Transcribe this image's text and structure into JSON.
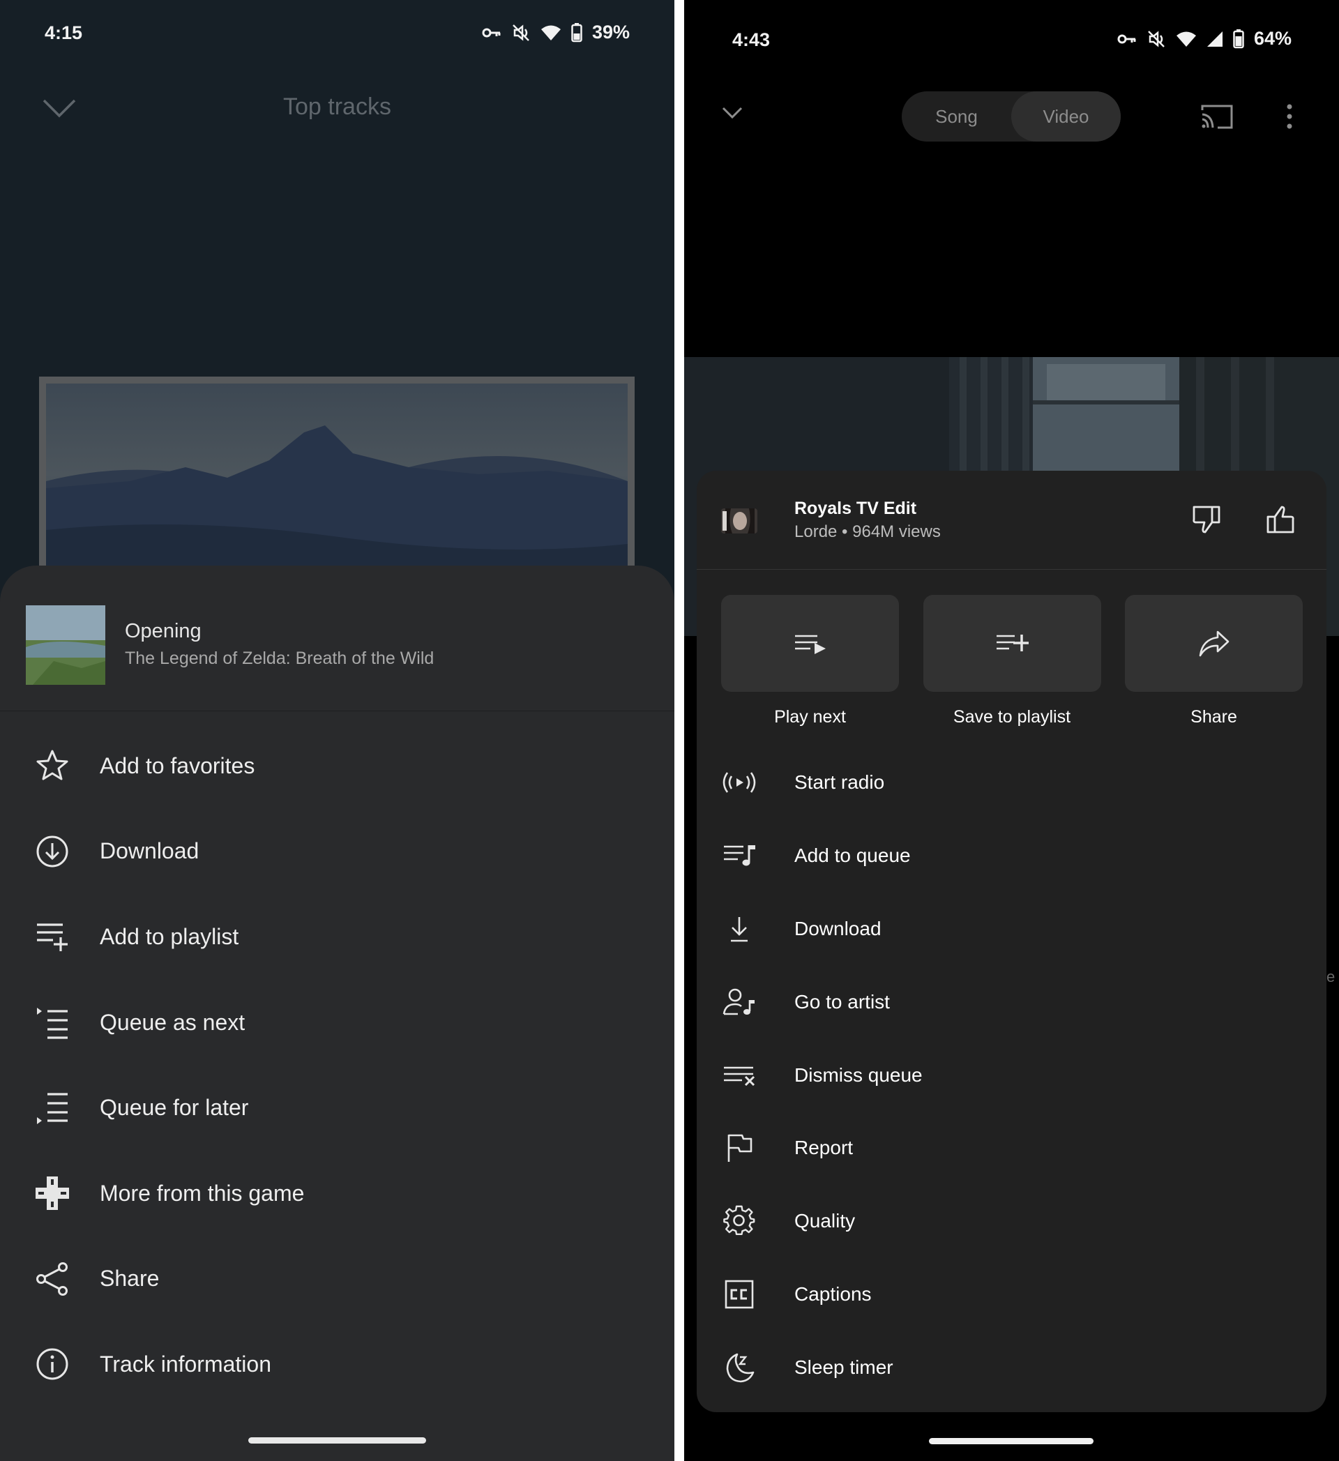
{
  "left": {
    "status": {
      "time": "4:15",
      "battery": "39%"
    },
    "header": {
      "title": "Top tracks"
    },
    "track": {
      "title": "Opening",
      "subtitle": "The Legend of Zelda: Breath of the Wild"
    },
    "menu": [
      {
        "label": "Add to favorites",
        "icon": "star-icon"
      },
      {
        "label": "Download",
        "icon": "download-circle-icon"
      },
      {
        "label": "Add to playlist",
        "icon": "playlist-add-icon"
      },
      {
        "label": "Queue as next",
        "icon": "queue-next-icon"
      },
      {
        "label": "Queue for later",
        "icon": "queue-later-icon"
      },
      {
        "label": "More from this game",
        "icon": "gamepad-icon"
      },
      {
        "label": "Share",
        "icon": "share-nodes-icon"
      },
      {
        "label": "Track information",
        "icon": "info-icon"
      }
    ]
  },
  "right": {
    "status": {
      "time": "4:43",
      "battery": "64%"
    },
    "toggle": {
      "song": "Song",
      "video": "Video"
    },
    "video": {
      "title": "Royals TV Edit",
      "subtitle": "Lorde • 964M views"
    },
    "actions": [
      {
        "label": "Play next",
        "icon": "play-next-icon"
      },
      {
        "label": "Save to playlist",
        "icon": "save-playlist-icon"
      },
      {
        "label": "Share",
        "icon": "share-arrow-icon"
      }
    ],
    "menu": [
      {
        "label": "Start radio",
        "icon": "radio-icon"
      },
      {
        "label": "Add to queue",
        "icon": "add-queue-icon"
      },
      {
        "label": "Download",
        "icon": "download-icon"
      },
      {
        "label": "Go to artist",
        "icon": "artist-icon"
      },
      {
        "label": "Dismiss queue",
        "icon": "dismiss-queue-icon"
      },
      {
        "label": "Report",
        "icon": "flag-icon"
      },
      {
        "label": "Quality",
        "icon": "gear-icon"
      },
      {
        "label": "Captions",
        "icon": "captions-icon"
      },
      {
        "label": "Sleep timer",
        "icon": "sleep-timer-icon"
      }
    ],
    "edge_text": "e"
  },
  "colors": {
    "left_background": "#161f26",
    "left_sheet": "#292a2c",
    "right_background": "#000000",
    "right_sheet": "#212121",
    "right_action_tile": "#323232"
  }
}
